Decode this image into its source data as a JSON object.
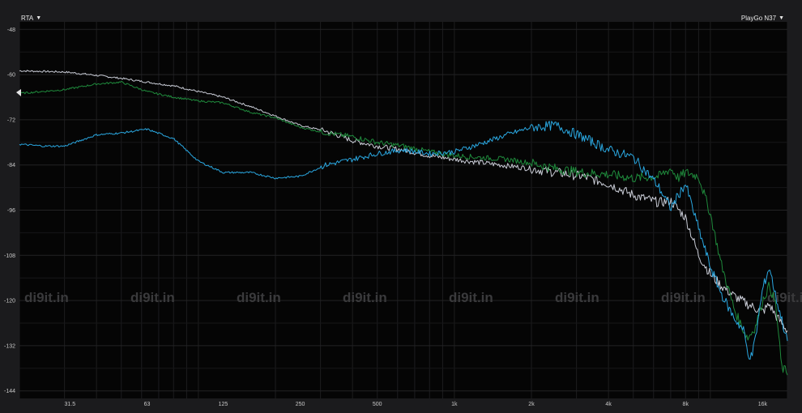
{
  "header": {
    "mode_label": "RTA",
    "device_label": "PlayGo N37"
  },
  "watermark": "di9it.in",
  "chart_data": {
    "type": "line",
    "xscale": "log",
    "xlim": [
      20,
      20000
    ],
    "ylim": [
      -146,
      -46
    ],
    "grid": true,
    "y_ticks": [
      -48,
      -60,
      -72,
      -84,
      -96,
      -108,
      -120,
      -132,
      -144
    ],
    "x_ticks": [
      {
        "value": 31.5,
        "label": "31.5"
      },
      {
        "value": 63,
        "label": "63"
      },
      {
        "value": 125,
        "label": "125"
      },
      {
        "value": 250,
        "label": "250"
      },
      {
        "value": 500,
        "label": "500"
      },
      {
        "value": 1000,
        "label": "1k"
      },
      {
        "value": 2000,
        "label": "2k"
      },
      {
        "value": 4000,
        "label": "4k"
      },
      {
        "value": 8000,
        "label": "8k"
      },
      {
        "value": 16000,
        "label": "16k"
      }
    ],
    "series": [
      {
        "color": "#c9ccd6",
        "x": [
          20,
          30,
          40,
          50,
          63,
          80,
          100,
          125,
          160,
          200,
          250,
          315,
          400,
          500,
          630,
          800,
          1000,
          1250,
          1600,
          2000,
          2500,
          3150,
          4000,
          5000,
          6300,
          7000,
          8000,
          9000,
          10000,
          11000,
          12500,
          14000,
          16000,
          17000,
          18000,
          20000
        ],
        "y": [
          -59,
          -59.3,
          -60.2,
          -61,
          -62,
          -63,
          -64.5,
          -66,
          -68.5,
          -71,
          -73.5,
          -75,
          -77.5,
          -79,
          -80,
          -81.5,
          -82.5,
          -83.3,
          -84.2,
          -85,
          -86,
          -87,
          -89,
          -92,
          -94,
          -93.5,
          -98,
          -108,
          -113,
          -116,
          -119,
          -121,
          -123,
          -121,
          -124,
          -128
        ]
      },
      {
        "color": "#1f8a3c",
        "x": [
          20,
          30,
          40,
          50,
          63,
          80,
          100,
          125,
          160,
          200,
          250,
          315,
          400,
          500,
          630,
          800,
          1000,
          1250,
          1600,
          2000,
          2500,
          3150,
          4000,
          5000,
          6300,
          7000,
          7500,
          8000,
          9000,
          10000,
          11000,
          12000,
          12500,
          13500,
          14000,
          15000,
          16000,
          17000,
          18000,
          19000,
          20000
        ],
        "y": [
          -65,
          -64,
          -62.5,
          -62,
          -64.5,
          -66,
          -67,
          -67.5,
          -70,
          -71.5,
          -74,
          -75.5,
          -76.5,
          -78,
          -79,
          -80.5,
          -81.5,
          -82,
          -82.5,
          -83.5,
          -85,
          -86,
          -86.5,
          -87.5,
          -87,
          -85,
          -87.5,
          -86,
          -87,
          -97,
          -110,
          -119,
          -123,
          -128,
          -130,
          -127,
          -120,
          -116,
          -121,
          -138,
          -139
        ]
      },
      {
        "color": "#2aa7e0",
        "x": [
          20,
          25,
          30,
          40,
          50,
          63,
          80,
          100,
          125,
          160,
          200,
          250,
          315,
          400,
          500,
          630,
          800,
          1000,
          1250,
          1600,
          2000,
          2500,
          3150,
          4000,
          5000,
          6000,
          6300,
          7000,
          7500,
          8000,
          9000,
          10000,
          11000,
          12000,
          12500,
          13500,
          14000,
          14500,
          15000,
          16000,
          17000,
          18000,
          19000,
          20000
        ],
        "y": [
          -78.5,
          -79,
          -79,
          -76,
          -75.5,
          -74.5,
          -77,
          -83,
          -86,
          -86,
          -87.5,
          -87,
          -84,
          -82.5,
          -81,
          -80,
          -81,
          -80.5,
          -78.5,
          -76,
          -74,
          -73.5,
          -76.5,
          -80,
          -82,
          -88,
          -90,
          -95.5,
          -92,
          -89,
          -101,
          -111,
          -118,
          -123,
          -125,
          -128,
          -134,
          -135,
          -130,
          -117,
          -111,
          -119,
          -125,
          -131
        ]
      }
    ]
  }
}
